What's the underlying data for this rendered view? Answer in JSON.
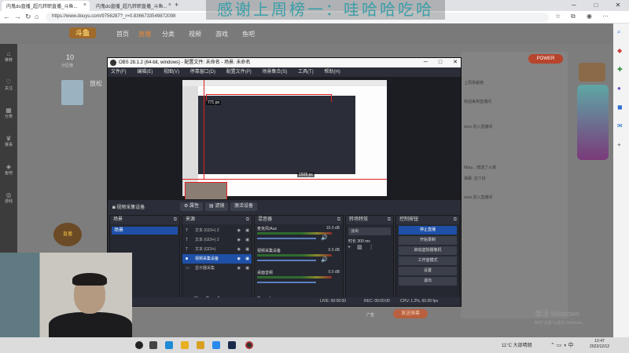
{
  "browser": {
    "tabs": [
      {
        "label": "内鬼do直播_超凡转职直播_斗鱼...",
        "active": true
      },
      {
        "label": "内鬼do直播_超凡转职直播_斗鱼...",
        "active": false
      },
      {
        "label": "内鬼do直播_超凡转职直播_斗鱼...",
        "active": false
      }
    ],
    "url": "https://www.douyu.com/9756287?_r=0.8366733549872098"
  },
  "overlay_title": "感谢上周榜一：哇哈哈吃哈",
  "site": {
    "logo": "斗鱼",
    "nav": [
      "首页",
      "直播",
      "分类",
      "视频",
      "游戏",
      "鱼吧"
    ],
    "active_nav": "直播",
    "streamer_number": "10",
    "streamer_sub": "分区榜",
    "anchor_name": "放松",
    "promo_label": "POWER",
    "send_label": "发送弹幕",
    "gift_label": "广告",
    "watermark": "激活 Windows",
    "watermark_sub": "转到“设置”以激活 Windows。"
  },
  "leftnav": [
    "推荐",
    "关注",
    "分类",
    "赛事",
    "鱼吧",
    "游戏"
  ],
  "chat_lines": [
    "上周贡献榜",
    "欢迎来到直播间",
    "xxxx 进入直播间",
    "Mary... 赠送了火箭",
    "弹幕: 这个好",
    "xxxx 进入直播间"
  ],
  "obs": {
    "title": "OBS 28.1.2 (64-bit, windows) - 配置文件: 未命名 - 场景: 未命名",
    "menu": [
      "文件(F)",
      "编辑(E)",
      "视图(V)",
      "停靠窗口(D)",
      "配置文件(P)",
      "场景集合(S)",
      "工具(T)",
      "帮助(H)"
    ],
    "preview_labels": {
      "height": "771 px",
      "width": "1508 px"
    },
    "source_name": "视频采集设备",
    "source_buttons": [
      "属性",
      "滤镜",
      "激活设备"
    ],
    "docks": {
      "scenes": {
        "title": "场景",
        "items": [
          "场景"
        ]
      },
      "sources": {
        "title": "来源",
        "items": [
          {
            "label": "文本 (GDI+) 2",
            "selected": false
          },
          {
            "label": "文本 (GDI+) 2",
            "selected": false
          },
          {
            "label": "文本 (GDI+)",
            "selected": false
          },
          {
            "label": "视频采集设备",
            "selected": true
          },
          {
            "label": "显示器采集",
            "selected": false
          }
        ]
      },
      "mixer": {
        "title": "混音器",
        "channels": [
          {
            "name": "麦克风/Aux",
            "db": "15.0 dB"
          },
          {
            "name": "视频采集设备",
            "db": "0.0 dB"
          },
          {
            "name": "桌面音频",
            "db": "0.0 dB"
          }
        ]
      },
      "transitions": {
        "title": "转场特效",
        "type": "淡出",
        "duration_label": "时长",
        "duration": "300 ms"
      },
      "controls": {
        "title": "控制按钮",
        "buttons": [
          "停止直播",
          "开始录制",
          "启动虚拟摄像机",
          "工作室模式",
          "设置",
          "退出"
        ]
      }
    },
    "status": {
      "live": "LIVE: 00:00:00",
      "rec": "REC: 00:00:00",
      "cpu": "CPU: 1.2%, 60.00 fps"
    }
  },
  "left_badge": "直播",
  "taskbar": {
    "weather": "11°C 大部晴朗",
    "time": "12:47",
    "date": "2022/12/12"
  },
  "colors": {
    "obs_bg": "#2b2e38",
    "obs_accent": "#1e50a8",
    "site_accent": "#e8893a",
    "overlay_text": "#3a9ea8"
  }
}
